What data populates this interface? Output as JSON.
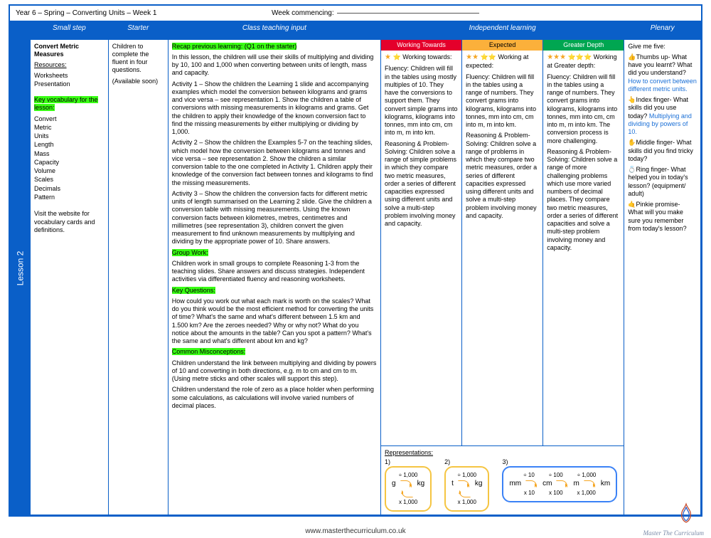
{
  "header": {
    "title": "Year 6 – Spring – Converting Units – Week 1",
    "week_commencing_label": "Week commencing:"
  },
  "side_label": "Lesson 2",
  "columns": {
    "small_step": "Small step",
    "starter": "Starter",
    "teaching": "Class teaching input",
    "independent": "Independent learning",
    "plenary": "Plenary"
  },
  "small_step": {
    "topic": "Convert Metric Measures",
    "resources_label": "Resources:",
    "resources": [
      "Worksheets",
      "Presentation"
    ],
    "vocab_label": "Key vocabulary for the lesson:",
    "vocab": [
      "Convert",
      "Metric",
      "Units",
      "Length",
      "Mass",
      "Capacity",
      "Volume",
      "Scales",
      "Decimals",
      "Pattern"
    ],
    "footnote": "Visit the website for vocabulary cards and definitions."
  },
  "starter": {
    "text": "Children to complete the fluent in four questions.",
    "note": "(Available soon)"
  },
  "teaching": {
    "recap_label": "Recap previous learning: (Q1 on the starter)",
    "intro": "In this lesson, the children will use their skills of multiplying and dividing by 10, 100 and 1,000 when converting between units of length, mass and capacity.",
    "act1": "Activity 1 – Show the children the Learning 1 slide and accompanying examples which model the conversion between kilograms and grams and vice versa – see representation 1. Show the children a table of conversions with missing measurements in kilograms and grams. Get the children to apply their knowledge of the known conversion fact to find the missing measurements by either multiplying or dividing by 1,000.",
    "act2": "Activity  2 –  Show the children the Examples 5-7 on the teaching slides, which model how the conversion between kilograms and tonnes and vice versa – see representation 2. Show the children a similar conversion table to the one completed in Activity 1. Children apply their knowledge of the conversion  fact between tonnes and kilograms to find the missing measurements.",
    "act3": "Activity 3 – Show the children the conversion facts for different metric units of length summarised on the Learning 2 slide. Give the children a conversion table with missing measurements. Using the known conversion facts between kilometres, metres, centimetres and millimetres (see representation 3), children convert the given measurement to find unknown measurements by multiplying and dividing by the appropriate power of 10. Share answers.",
    "group_label": "Group Work:",
    "group": "Children work in small groups to complete Reasoning 1-3 from the teaching slides. Share answers and discuss strategies. Independent activities via differentiated fluency and reasoning worksheets.",
    "kq_label": "Key Questions:",
    "kq": "How could you work out what each mark is worth on the scales? What do you think would be the most efficient method for converting the units of time? What's the same and what's different between 1.5 km and 1.500 km? Are the zeroes needed? Why or why not? What do you notice about the amounts in the table? Can you spot a pattern? What's the same and what's different about km and kg?",
    "cm_label": "Common Misconceptions:",
    "cm1": "Children understand the link between multiplying and dividing by powers of 10 and converting in both directions, e.g. m to cm and cm to m. (Using metre sticks and other scales will support this step).",
    "cm2": "Children understand the role of zero as a place holder when performing some calculations, as calculations will involve varied numbers of decimal places."
  },
  "independent": {
    "wt_label": "Working Towards",
    "ex_label": "Expected",
    "gd_label": "Greater Depth",
    "wt": {
      "head": "⭐ Working towards:",
      "fluency": "Fluency: Children will fill in the tables using mostly multiples of 10. They have the conversions to support them. They convert simple grams into kilograms, kilograms into tonnes, mm into cm, cm into m, m into km.",
      "rp": "Reasoning & Problem-Solving: Children solve a range of simple problems in which they compare two metric measures, order a series of different capacities expressed using different units and solve a multi-step problem involving money and capacity."
    },
    "ex": {
      "head": "⭐⭐ Working at expected:",
      "fluency": "Fluency: Children will fill in the tables using a range of numbers. They convert grams into kilograms, kilograms into tonnes, mm into cm, cm into m, m into km.",
      "rp": "Reasoning & Problem-Solving: Children solve a range of problems in which they compare two metric measures, order a series of different capacities expressed using different units and solve a multi-step problem involving money and capacity."
    },
    "gd": {
      "head": "⭐⭐⭐ Working at Greater depth:",
      "fluency": "Fluency: Children will fill in the tables using a range of numbers. They convert grams into kilograms, kilograms into tonnes, mm into cm, cm into m, m into km. The conversion process is more challenging.",
      "rp": "Reasoning & Problem-Solving: Children solve a range of more challenging problems which use more varied numbers of decimal places. They compare two metric measures, order a series of different capacities and solve a multi-step problem involving money and capacity."
    },
    "reps_label": "Representations:",
    "rep1": {
      "top": "÷ 1,000",
      "left": "g",
      "right": "kg",
      "bottom": "x 1,000"
    },
    "rep2": {
      "top": "÷ 1,000",
      "left": "t",
      "right": "kg",
      "bottom": "x 1,000"
    },
    "rep3": {
      "top": [
        "÷ 10",
        "÷ 100",
        "÷ 1,000"
      ],
      "units": [
        "mm",
        "cm",
        "m",
        "km"
      ],
      "bottom": [
        "x 10",
        "x 100",
        "x 1,000"
      ]
    }
  },
  "plenary": {
    "intro": "Give me five:",
    "thumbs_label": "👍Thumbs up- What have you learnt? What did you understand?",
    "thumbs_ans": "How to convert between different metric units.",
    "index_label": "👆Index finger- What skills did you use today?",
    "index_ans": "Multiplying and dividing by powers of 10.",
    "middle": "✋Middle finger- What skills did you find tricky today?",
    "ring": "💍Ring finger- What helped you in today's lesson? (equipment/ adult)",
    "pinkie": "🤙Pinkie promise- What will you make sure you remember from today's lesson?"
  },
  "footer": {
    "url": "www.masterthecurriculum.co.uk",
    "brand": "Master The Curriculum"
  }
}
